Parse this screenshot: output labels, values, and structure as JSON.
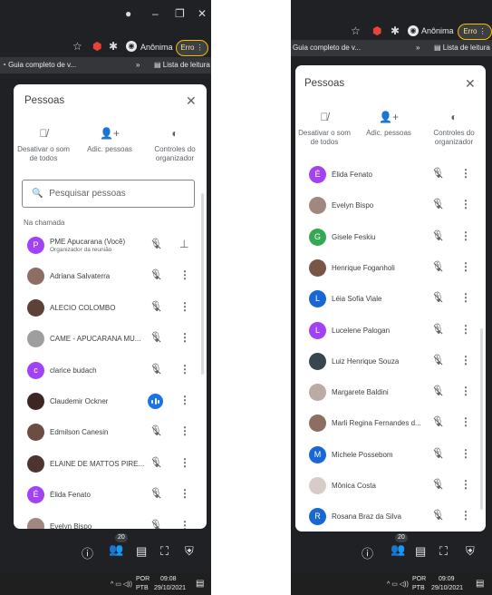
{
  "page_number": "58",
  "left": {
    "bookmark": "Guia completo de v...",
    "bookmark_more": "»",
    "reading_list": "Lista de leitura",
    "anon_label": "Anônima",
    "erro": "Erro",
    "panel_title": "Pessoas",
    "actions": [
      {
        "label": "Desativar o som de todos",
        "icon": "mic-off-icon"
      },
      {
        "label": "Adic. pessoas",
        "icon": "add-person-icon"
      },
      {
        "label": "Controles do organizador",
        "icon": "toggle-icon"
      }
    ],
    "search_placeholder": "Pesquisar pessoas",
    "section": "Na chamada",
    "participants": [
      {
        "name": "PME Apucarana (Você)",
        "sub": "Organizador da reunião",
        "avatar": "P",
        "color": "#a142f4",
        "right": "pin"
      },
      {
        "name": "Adriana Salvaterra",
        "avatar": "",
        "color": "#8d6e63"
      },
      {
        "name": "ALECIO COLOMBO",
        "avatar": "",
        "color": "#5d4037"
      },
      {
        "name": "CAME - APUCARANA MU...",
        "avatar": "",
        "color": "#9e9e9e"
      },
      {
        "name": "clarice budach",
        "avatar": "c",
        "color": "#a142f4"
      },
      {
        "name": "Claudemir Ockner",
        "avatar": "",
        "color": "#3e2723",
        "speaking": true
      },
      {
        "name": "Edmilson Canesin",
        "avatar": "",
        "color": "#6d4c41"
      },
      {
        "name": "ELAINE DE MATTOS PIRE...",
        "avatar": "",
        "color": "#4e342e"
      },
      {
        "name": "Élida Fenato",
        "avatar": "É",
        "color": "#a142f4"
      },
      {
        "name": "Evelyn Bispo",
        "avatar": "",
        "color": "#a1887f"
      }
    ],
    "count_badge": "20",
    "tray": {
      "lang": "POR",
      "layout": "PTB",
      "time": "09:08",
      "date": "29/10/2021"
    }
  },
  "right": {
    "bookmark": "Guia completo de v...",
    "bookmark_more": "»",
    "reading_list": "Lista de leitura",
    "anon_label": "Anônima",
    "erro": "Erro",
    "panel_title": "Pessoas",
    "actions": [
      {
        "label": "Desativar o som de todos",
        "icon": "mic-off-icon"
      },
      {
        "label": "Adic. pessoas",
        "icon": "add-person-icon"
      },
      {
        "label": "Controles do organizador",
        "icon": "toggle-icon"
      }
    ],
    "participants": [
      {
        "name": "Élida Fenato",
        "avatar": "É",
        "color": "#a142f4"
      },
      {
        "name": "Evelyn Bispo",
        "avatar": "",
        "color": "#a1887f"
      },
      {
        "name": "Gisele Feskiu",
        "avatar": "G",
        "color": "#34a853"
      },
      {
        "name": "Henrique Foganholi",
        "avatar": "",
        "color": "#795548"
      },
      {
        "name": "Léia Sofia Viale",
        "avatar": "L",
        "color": "#1967d2"
      },
      {
        "name": "Lucelene Palogan",
        "avatar": "L",
        "color": "#a142f4"
      },
      {
        "name": "Luiz Henrique Souza",
        "avatar": "",
        "color": "#37474f"
      },
      {
        "name": "Margarete Baldini",
        "avatar": "",
        "color": "#bcaaa4"
      },
      {
        "name": "Marli Regina Fernandes d...",
        "avatar": "",
        "color": "#8d6e63"
      },
      {
        "name": "Michele Possebom",
        "avatar": "M",
        "color": "#1967d2"
      },
      {
        "name": "Mônica Costa",
        "avatar": "",
        "color": "#d7ccc8"
      },
      {
        "name": "Rosana Braz da Silva",
        "avatar": "R",
        "color": "#1967d2"
      }
    ],
    "count_badge": "20",
    "tray": {
      "lang": "POR",
      "layout": "PTB",
      "time": "09:09",
      "date": "29/10/2021"
    }
  }
}
